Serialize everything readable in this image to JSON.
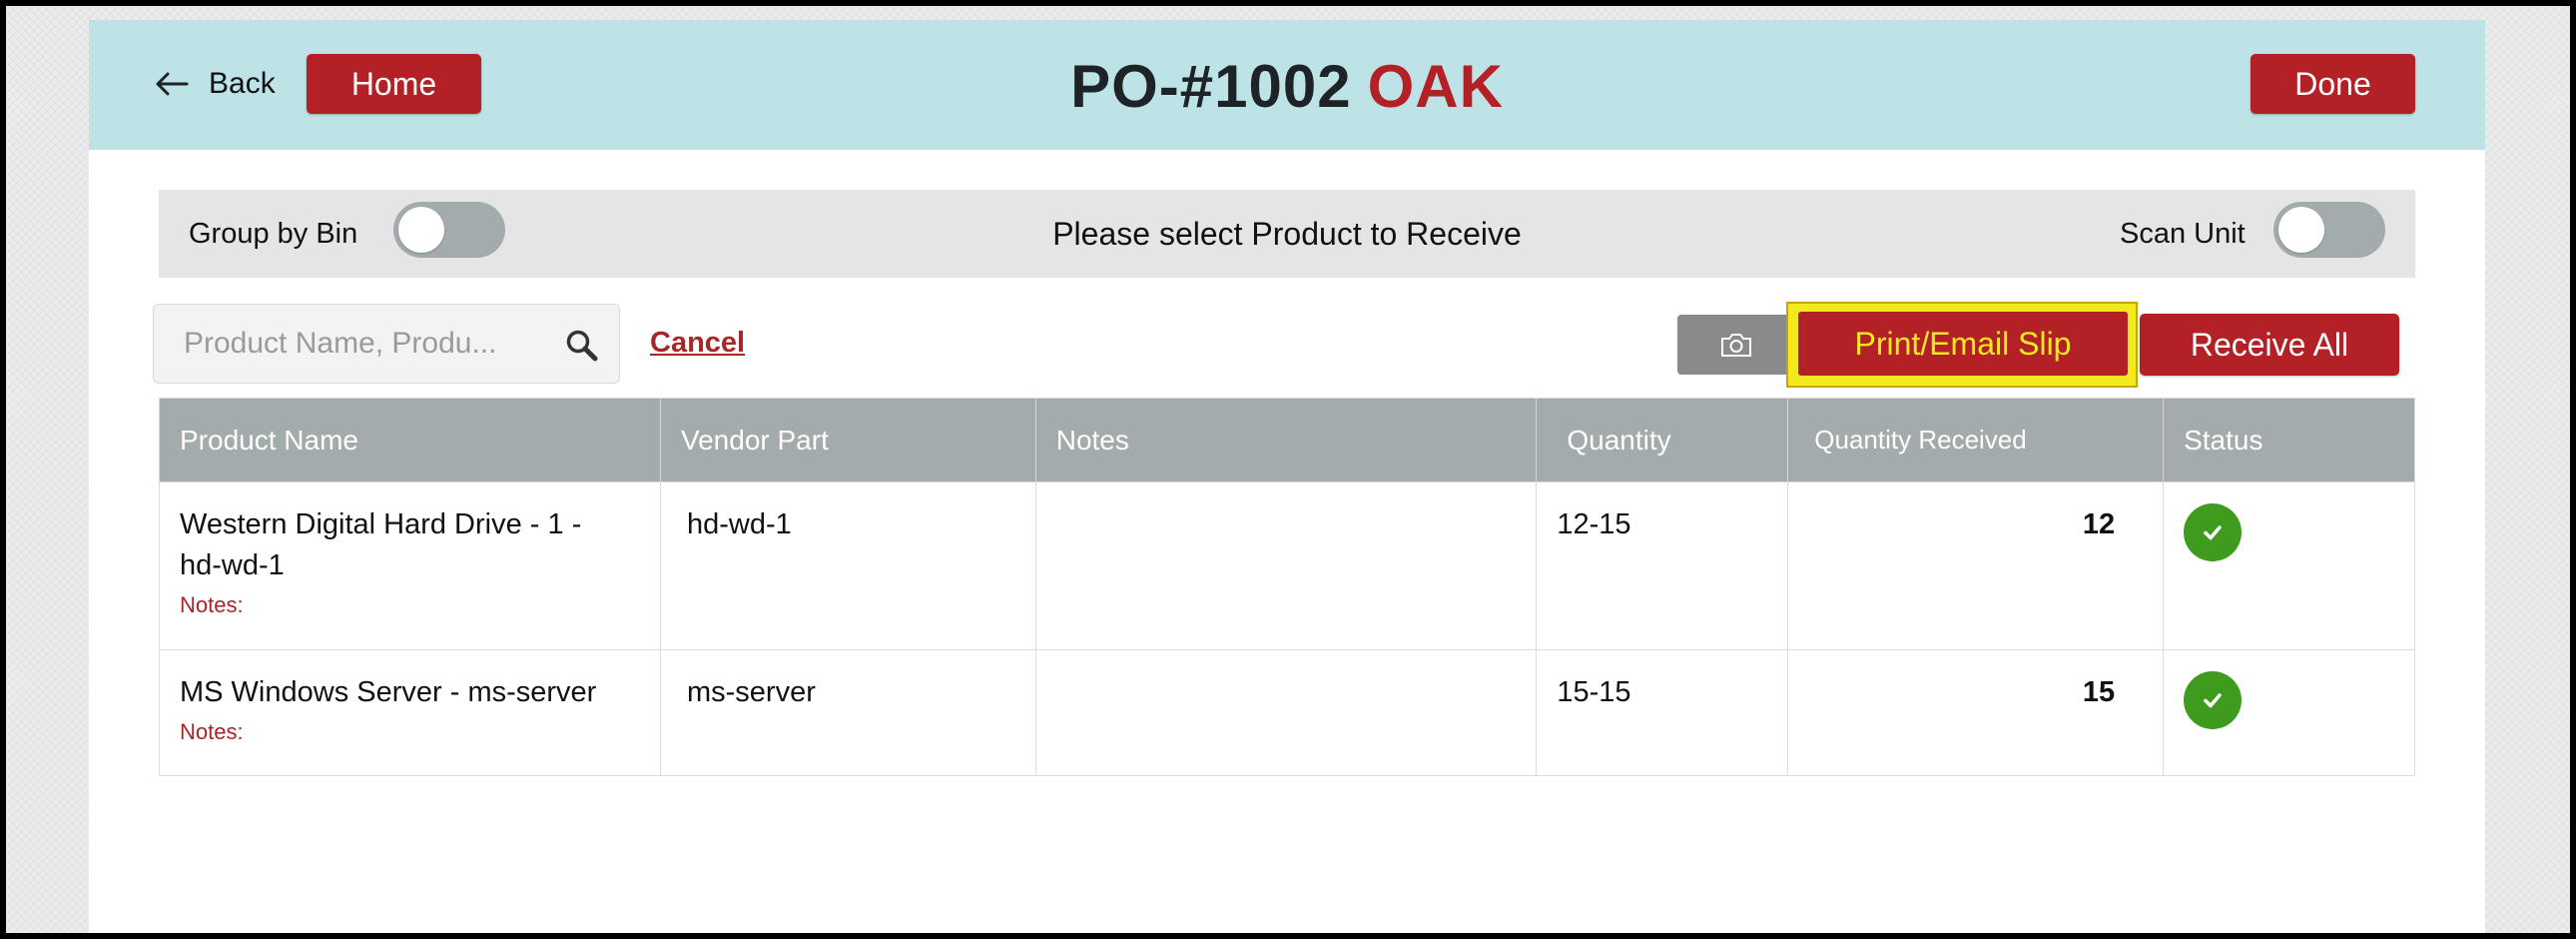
{
  "header": {
    "back_label": "Back",
    "home_label": "Home",
    "po_number": "PO-#1002",
    "location": "OAK",
    "done_label": "Done"
  },
  "options_bar": {
    "group_by_bin_label": "Group by Bin",
    "group_by_bin_on": false,
    "instruction": "Please select Product to Receive",
    "scan_unit_label": "Scan Unit",
    "scan_unit_on": false
  },
  "toolbar": {
    "search_placeholder": "Product Name, Produ...",
    "cancel_label": "Cancel",
    "print_label": "Print/Email Slip",
    "receive_all_label": "Receive All"
  },
  "table": {
    "columns": [
      "Product Name",
      "Vendor Part",
      "Notes",
      "Quantity",
      "Quantity Received",
      "Status"
    ],
    "notes_label": "Notes:",
    "rows": [
      {
        "product_name": "Western Digital Hard Drive - 1 - hd-wd-1",
        "vendor_part": "hd-wd-1",
        "notes": "",
        "quantity": "12-15",
        "quantity_received": "12",
        "status": "received"
      },
      {
        "product_name": "MS Windows Server - ms-server",
        "vendor_part": "ms-server",
        "notes": "",
        "quantity": "15-15",
        "quantity_received": "15",
        "status": "received"
      }
    ]
  },
  "colors": {
    "header_bg": "#bde3e6",
    "brand_red": "#b32025",
    "highlight_yellow": "#f2ea1c",
    "table_header_bg": "#a3abad",
    "status_green": "#3f9b1e"
  },
  "icons": {
    "back": "arrow-left-icon",
    "search": "magnifier-icon",
    "camera": "camera-icon",
    "status": "check-circle-icon"
  }
}
